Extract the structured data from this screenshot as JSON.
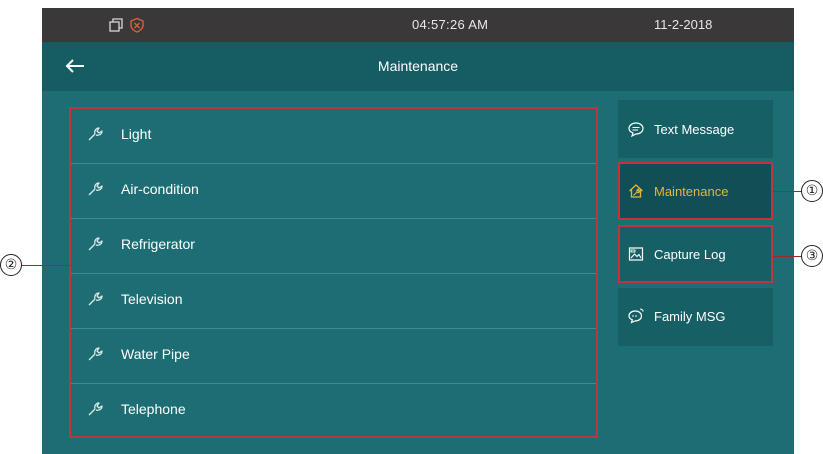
{
  "statusbar": {
    "time": "04:57:26   AM",
    "date": "11-2-2018",
    "icons": [
      "window-icon",
      "shield-icon"
    ]
  },
  "header": {
    "title": "Maintenance",
    "back_icon": "arrow-left-icon"
  },
  "maintenance_list": {
    "items": [
      {
        "label": "Light",
        "icon": "wrench-icon"
      },
      {
        "label": "Air-condition",
        "icon": "wrench-icon"
      },
      {
        "label": "Refrigerator",
        "icon": "wrench-icon"
      },
      {
        "label": "Television",
        "icon": "wrench-icon"
      },
      {
        "label": "Water Pipe",
        "icon": "wrench-icon"
      },
      {
        "label": "Telephone",
        "icon": "wrench-icon"
      }
    ]
  },
  "sidebar": {
    "buttons": [
      {
        "label": "Text Message",
        "icon": "chat-bubble-icon"
      },
      {
        "label": "Maintenance",
        "icon": "house-wrench-icon",
        "active": true
      },
      {
        "label": "Capture Log",
        "icon": "image-icon"
      },
      {
        "label": "Family MSG",
        "icon": "family-message-icon"
      }
    ]
  },
  "callouts": [
    "①",
    "②",
    "③"
  ],
  "colors": {
    "screen_bg": "#1d6e74",
    "title_bg": "#155d63",
    "statusbar_bg": "#3a3838",
    "highlight_border": "#c0353d",
    "active_text": "#e8b43a"
  }
}
